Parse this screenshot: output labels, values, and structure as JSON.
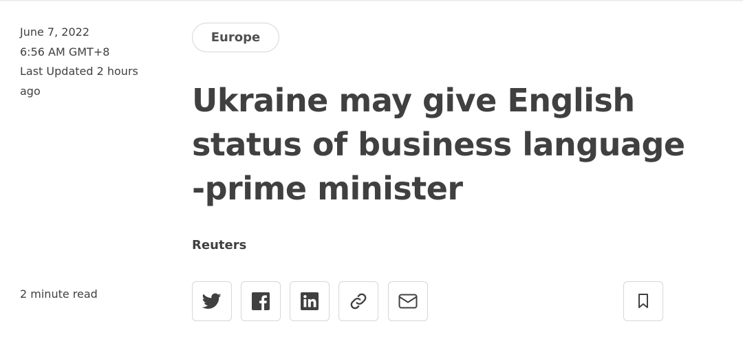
{
  "article": {
    "date": "June 7, 2022",
    "time": "6:56 AM GMT+8",
    "updated": "Last Updated 2 hours ago",
    "read_time": "2 minute read",
    "category": "Europe",
    "headline": "Ukraine may give English status of business language -prime minister",
    "byline": "Reuters"
  },
  "share": {
    "buttons": [
      {
        "icon": "twitter-icon"
      },
      {
        "icon": "facebook-icon"
      },
      {
        "icon": "linkedin-icon"
      },
      {
        "icon": "link-icon"
      },
      {
        "icon": "email-icon"
      }
    ],
    "bookmark_icon": "bookmark-icon"
  },
  "colors": {
    "text": "#404040",
    "border": "#d6d6d6",
    "background": "#ffffff"
  }
}
